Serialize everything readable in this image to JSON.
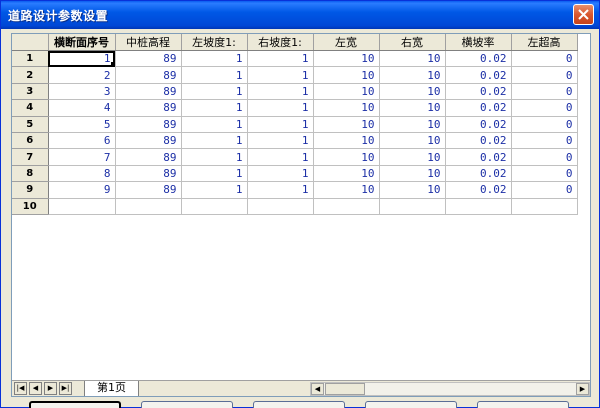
{
  "window": {
    "title": "道路设计参数设置"
  },
  "columns": [
    "横断面序号",
    "中桩高程",
    "左坡度1:",
    "右坡度1:",
    "左宽",
    "右宽",
    "横坡率",
    "左超高"
  ],
  "row_headers": [
    "1",
    "2",
    "3",
    "4",
    "5",
    "6",
    "7",
    "8",
    "9",
    "10"
  ],
  "rows": [
    [
      "1",
      "89",
      "1",
      "1",
      "10",
      "10",
      "0.02",
      "0"
    ],
    [
      "2",
      "89",
      "1",
      "1",
      "10",
      "10",
      "0.02",
      "0"
    ],
    [
      "3",
      "89",
      "1",
      "1",
      "10",
      "10",
      "0.02",
      "0"
    ],
    [
      "4",
      "89",
      "1",
      "1",
      "10",
      "10",
      "0.02",
      "0"
    ],
    [
      "5",
      "89",
      "1",
      "1",
      "10",
      "10",
      "0.02",
      "0"
    ],
    [
      "6",
      "89",
      "1",
      "1",
      "10",
      "10",
      "0.02",
      "0"
    ],
    [
      "7",
      "89",
      "1",
      "1",
      "10",
      "10",
      "0.02",
      "0"
    ],
    [
      "8",
      "89",
      "1",
      "1",
      "10",
      "10",
      "0.02",
      "0"
    ],
    [
      "9",
      "89",
      "1",
      "1",
      "10",
      "10",
      "0.02",
      "0"
    ],
    [
      "",
      "",
      "",
      "",
      "",
      "",
      "",
      ""
    ]
  ],
  "sheet_tab": "第1页",
  "nav": {
    "first": "|◀",
    "prev": "◀",
    "next": "▶",
    "last": "▶|"
  },
  "scroll": {
    "left": "◀",
    "right": "▶"
  },
  "colors": {
    "titlebar": "#0058e6",
    "cell_text": "#1c2fa6",
    "face": "#ece9d8"
  }
}
